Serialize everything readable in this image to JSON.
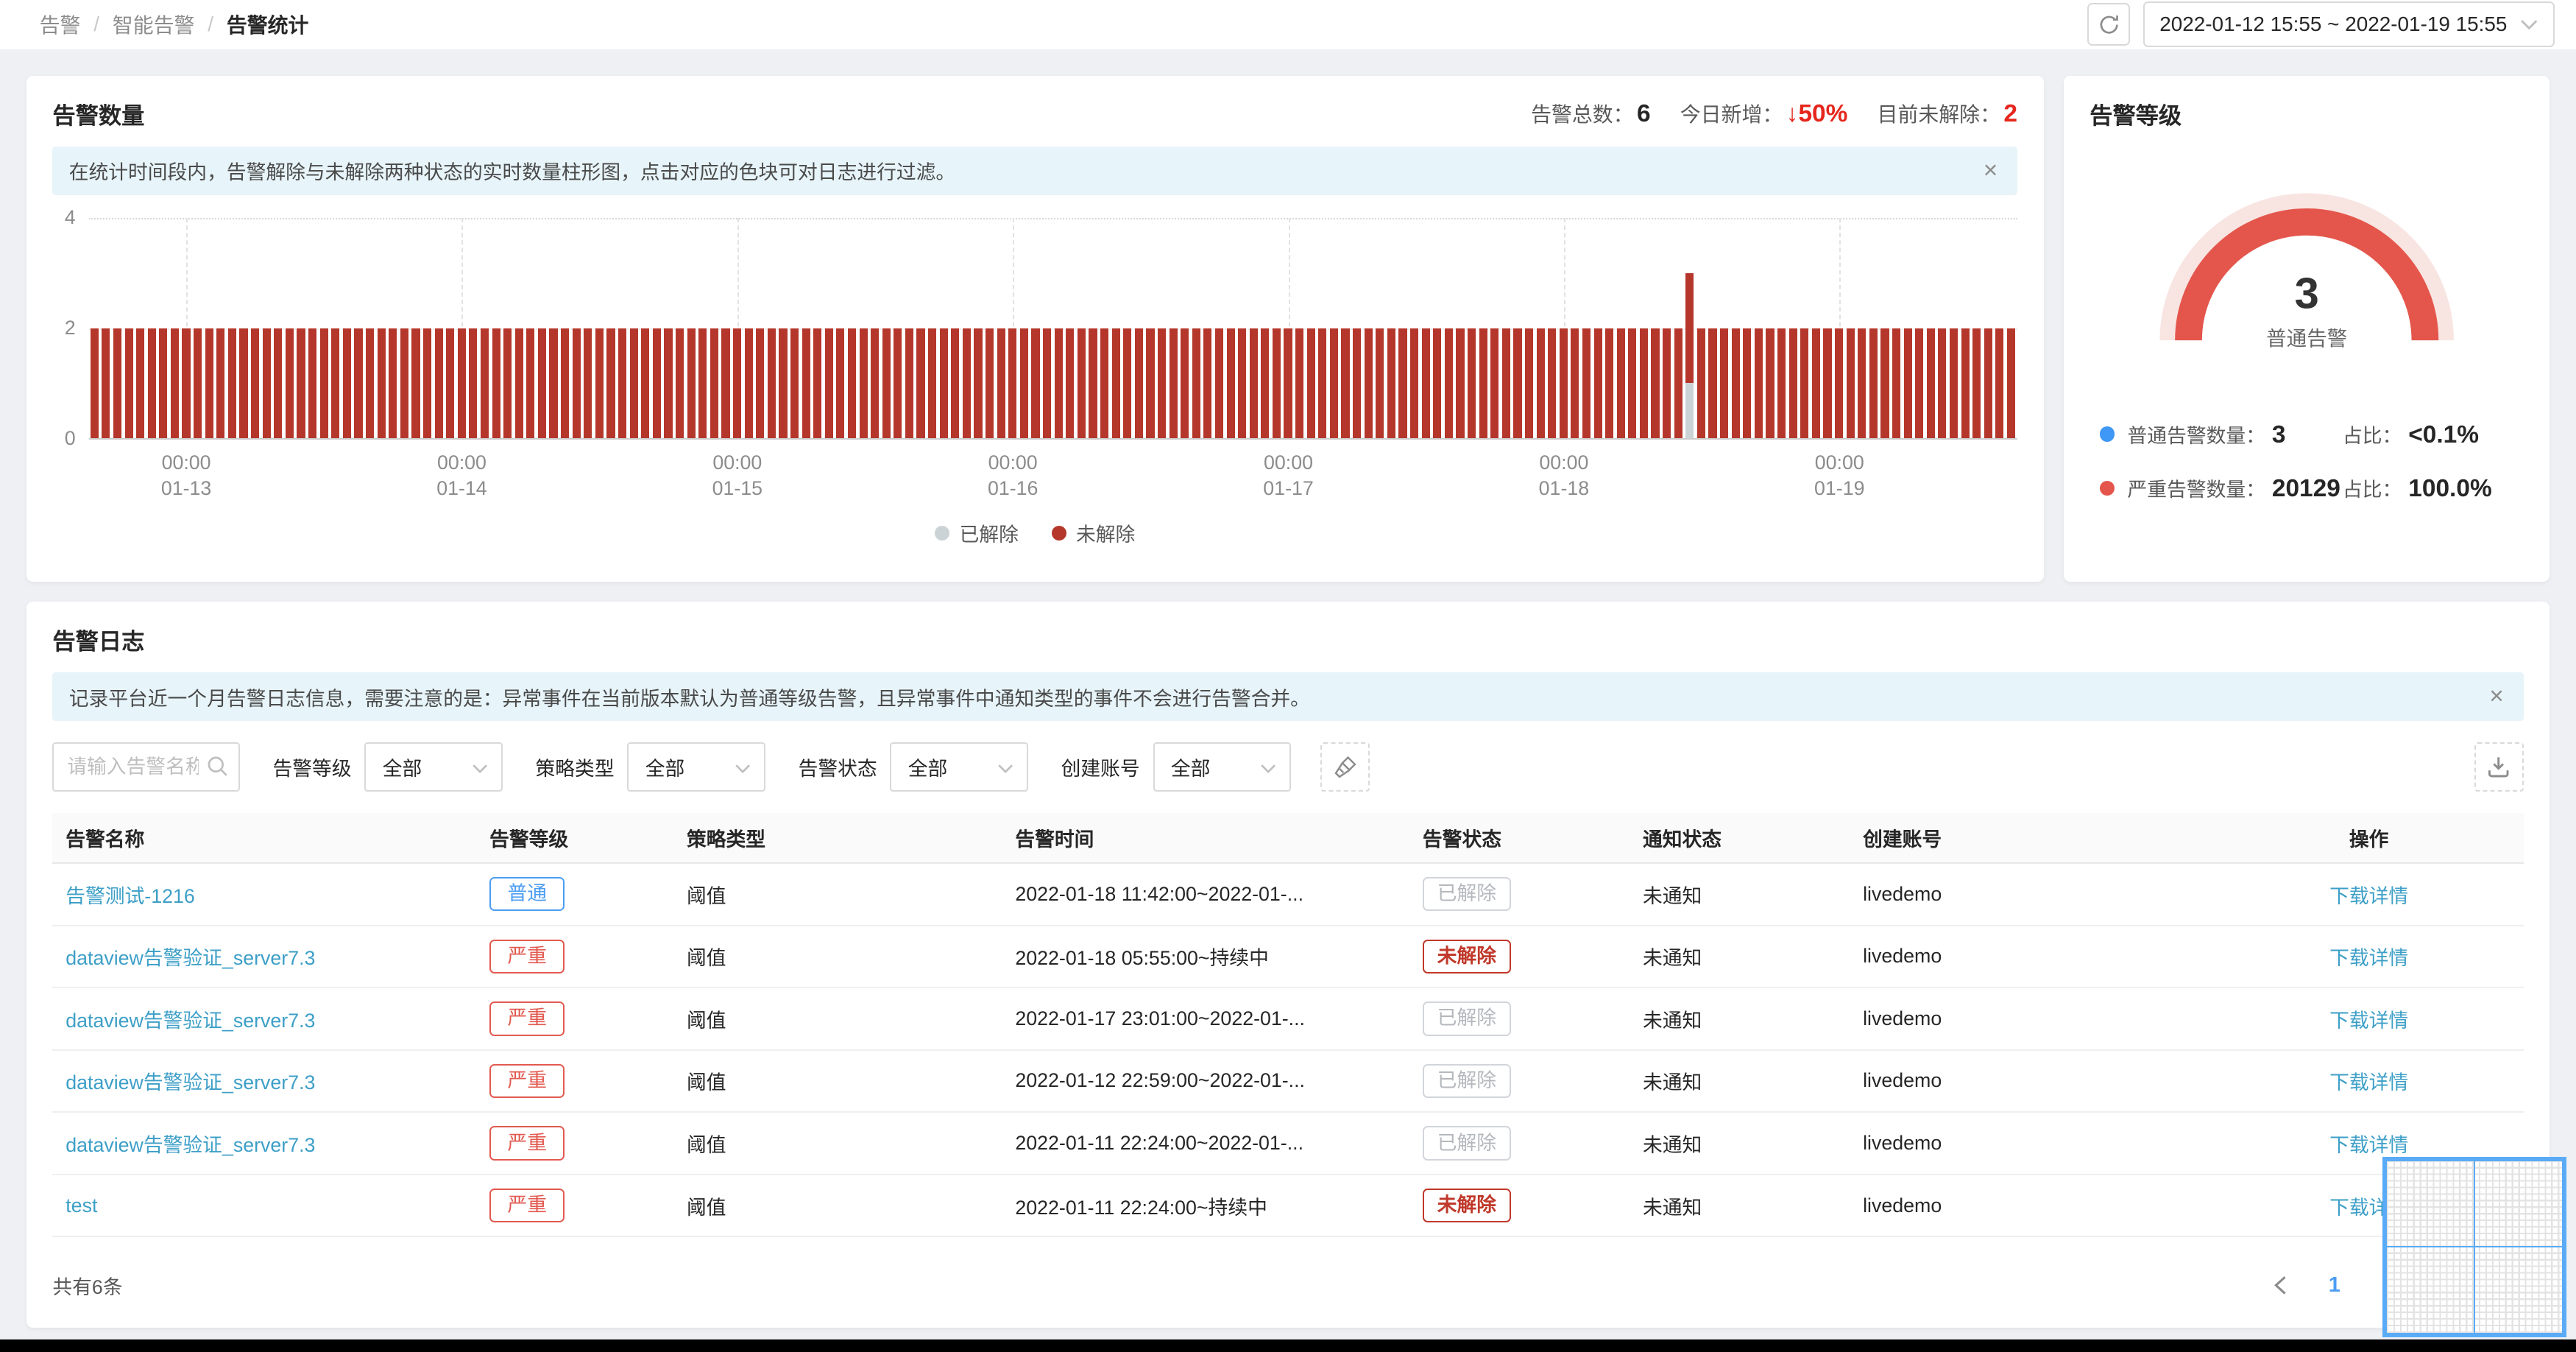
{
  "breadcrumb": {
    "items": [
      "告警",
      "智能告警",
      "告警统计"
    ],
    "separator": "/"
  },
  "toolbar": {
    "date_range": "2022-01-12 15:55 ~ 2022-01-19 15:55"
  },
  "icons": {
    "close": "×"
  },
  "colors": {
    "link": "#3d9fc7",
    "primary_blue": "#4d9df2",
    "severe_badge": "#e25a50",
    "unresolved_badge": "#c0392b",
    "stat_red": "#e5261c"
  },
  "alert_count_card": {
    "title": "告警数量",
    "stats": [
      {
        "label": "告警总数：",
        "value": "6",
        "color": "dark"
      },
      {
        "label": "今日新增：",
        "value": "↓50%",
        "color": "red"
      },
      {
        "label": "目前未解除：",
        "value": "2",
        "color": "red"
      }
    ],
    "banner": "在统计时间段内，告警解除与未解除两种状态的实时数量柱形图，点击对应的色块可对日志进行过滤。"
  },
  "chart_data": {
    "type": "bar",
    "stacked": true,
    "x_description": "每小时一个柱，时间范围 2022-01-12 16:00 至 2022-01-19 15:00",
    "bar_count": 168,
    "ylim": [
      0,
      4
    ],
    "y_ticks": [
      0,
      2,
      4
    ],
    "grid": true,
    "legend_position": "bottom",
    "day_ticks": [
      {
        "index": 8,
        "time": "00:00",
        "date": "01-13"
      },
      {
        "index": 32,
        "time": "00:00",
        "date": "01-14"
      },
      {
        "index": 56,
        "time": "00:00",
        "date": "01-15"
      },
      {
        "index": 80,
        "time": "00:00",
        "date": "01-16"
      },
      {
        "index": 104,
        "time": "00:00",
        "date": "01-17"
      },
      {
        "index": 128,
        "time": "00:00",
        "date": "01-18"
      },
      {
        "index": 152,
        "time": "00:00",
        "date": "01-19"
      }
    ],
    "series": [
      {
        "name": "已解除",
        "color": "#ccd3d6",
        "values_rle": [
          [
            139,
            0
          ],
          [
            1,
            1
          ],
          [
            28,
            0
          ]
        ]
      },
      {
        "name": "未解除",
        "color": "#b5372b",
        "values_rle": [
          [
            168,
            2
          ]
        ]
      }
    ]
  },
  "alert_level_card": {
    "title": "告警等级",
    "gauge": {
      "value": "3",
      "label": "普通告警",
      "color": "#e4564b",
      "track_color": "#f8e5e2"
    },
    "legend": [
      {
        "dot_color": "#3f97f6",
        "label": "普通告警数量：",
        "value": "3",
        "ratio_label": "占比：",
        "ratio": "<0.1%"
      },
      {
        "dot_color": "#e4564b",
        "label": "严重告警数量：",
        "value": "20129",
        "ratio_label": "占比：",
        "ratio": "100.0%"
      }
    ]
  },
  "log_card": {
    "title": "告警日志",
    "banner": "记录平台近一个月告警日志信息，需要注意的是：异常事件在当前版本默认为普通等级告警，且异常事件中通知类型的事件不会进行告警合并。",
    "filters": {
      "search_placeholder": "请输入告警名称",
      "selects": [
        {
          "label": "告警等级",
          "value": "全部"
        },
        {
          "label": "策略类型",
          "value": "全部"
        },
        {
          "label": "告警状态",
          "value": "全部"
        },
        {
          "label": "创建账号",
          "value": "全部"
        }
      ]
    },
    "table": {
      "columns": [
        "告警名称",
        "告警等级",
        "策略类型",
        "告警时间",
        "告警状态",
        "通知状态",
        "创建账号",
        "操作"
      ],
      "rows": [
        {
          "name": "告警测试-1216",
          "level": "普通",
          "level_type": "normal",
          "policy": "阈值",
          "time": "2022-01-18 11:42:00~2022-01-...",
          "status": "已解除",
          "status_type": "resolved",
          "notify": "未通知",
          "account": "livedemo",
          "action": "下载详情"
        },
        {
          "name": "dataview告警验证_server7.3",
          "level": "严重",
          "level_type": "severe",
          "policy": "阈值",
          "time": "2022-01-18 05:55:00~持续中",
          "status": "未解除",
          "status_type": "unresolved",
          "notify": "未通知",
          "account": "livedemo",
          "action": "下载详情"
        },
        {
          "name": "dataview告警验证_server7.3",
          "level": "严重",
          "level_type": "severe",
          "policy": "阈值",
          "time": "2022-01-17 23:01:00~2022-01-...",
          "status": "已解除",
          "status_type": "resolved",
          "notify": "未通知",
          "account": "livedemo",
          "action": "下载详情"
        },
        {
          "name": "dataview告警验证_server7.3",
          "level": "严重",
          "level_type": "severe",
          "policy": "阈值",
          "time": "2022-01-12 22:59:00~2022-01-...",
          "status": "已解除",
          "status_type": "resolved",
          "notify": "未通知",
          "account": "livedemo",
          "action": "下载详情"
        },
        {
          "name": "dataview告警验证_server7.3",
          "level": "严重",
          "level_type": "severe",
          "policy": "阈值",
          "time": "2022-01-11 22:24:00~2022-01-...",
          "status": "已解除",
          "status_type": "resolved",
          "notify": "未通知",
          "account": "livedemo",
          "action": "下载详情"
        },
        {
          "name": "test",
          "level": "严重",
          "level_type": "severe",
          "policy": "阈值",
          "time": "2022-01-11 22:24:00~持续中",
          "status": "未解除",
          "status_type": "unresolved",
          "notify": "未通知",
          "account": "livedemo",
          "action": "下载详情"
        }
      ]
    },
    "footer": {
      "total": "共有6条",
      "page": "1"
    }
  }
}
